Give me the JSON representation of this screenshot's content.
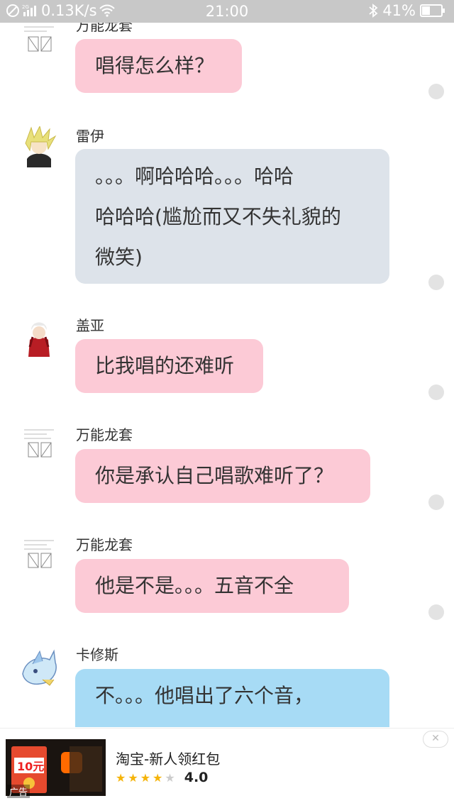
{
  "status_bar": {
    "network_speed": "0.13K/s",
    "network_type": "2G",
    "time": "21:00",
    "battery_percent": "41%",
    "battery_level": 0.41,
    "icons": [
      "no-disturb-icon",
      "signal-icon",
      "wifi-icon",
      "bluetooth-icon",
      "battery-icon"
    ]
  },
  "messages": [
    {
      "sender": "万能龙套",
      "text": "唱得怎么样？",
      "bubble_color": "#fccad6",
      "avatar": "sketch-avatar"
    },
    {
      "sender": "雷伊",
      "text": "。。。啊哈哈哈。。。哈哈\n哈哈哈(尴尬而又不失礼貌的\n微笑)",
      "bubble_color": "#dde3ea",
      "avatar": "blonde-character-avatar"
    },
    {
      "sender": "盖亚",
      "text": "比我唱的还难听",
      "bubble_color": "#fccad6",
      "avatar": "red-character-avatar"
    },
    {
      "sender": "万能龙套",
      "text": "你是承认自己唱歌难听了？",
      "bubble_color": "#fccad6",
      "avatar": "sketch-avatar"
    },
    {
      "sender": "万能龙套",
      "text": "他是不是。。。五音不全",
      "bubble_color": "#fccad6",
      "avatar": "sketch-avatar"
    },
    {
      "sender": "卡修斯",
      "text": "不。。。他唱出了六个音，",
      "bubble_color": "#a7dbf5",
      "avatar": "blue-creature-avatar"
    }
  ],
  "ad": {
    "title": "淘宝-新人领红包",
    "rating": "4.0",
    "stars_filled": 4,
    "stars_total": 5,
    "price_label": "10元",
    "tag": "广告",
    "close_icon": "close-icon",
    "colors": {
      "star": "#f5b40a",
      "star_empty": "#cccccc"
    }
  }
}
